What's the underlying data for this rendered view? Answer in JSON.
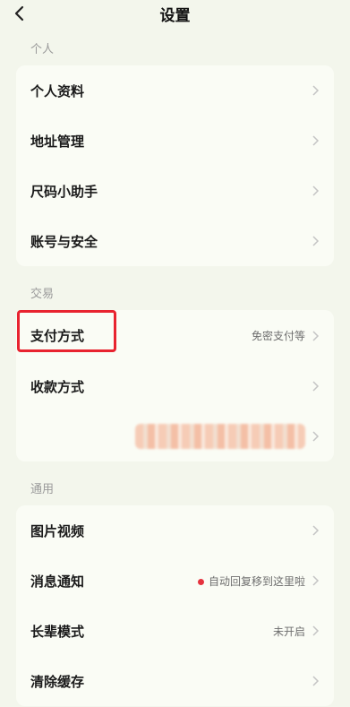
{
  "header": {
    "title": "设置"
  },
  "sections": {
    "personal": {
      "label": "个人",
      "items": [
        {
          "label": "个人资料",
          "value": ""
        },
        {
          "label": "地址管理",
          "value": ""
        },
        {
          "label": "尺码小助手",
          "value": ""
        },
        {
          "label": "账号与安全",
          "value": ""
        }
      ]
    },
    "trade": {
      "label": "交易",
      "items": [
        {
          "label": "支付方式",
          "value": "免密支付等"
        },
        {
          "label": "收款方式",
          "value": ""
        },
        {
          "label": "",
          "value": ""
        }
      ]
    },
    "general": {
      "label": "通用",
      "items": [
        {
          "label": "图片视频",
          "value": ""
        },
        {
          "label": "消息通知",
          "value": "自动回复移到这里啦"
        },
        {
          "label": "长辈模式",
          "value": "未开启"
        },
        {
          "label": "清除缓存",
          "value": ""
        }
      ]
    }
  },
  "colors": {
    "highlight": "#e8232f",
    "notification_dot": "#e5323e",
    "background": "#f3f6ec"
  },
  "icons": {
    "back": "chevron-left-icon",
    "row_arrow": "chevron-right-icon"
  }
}
